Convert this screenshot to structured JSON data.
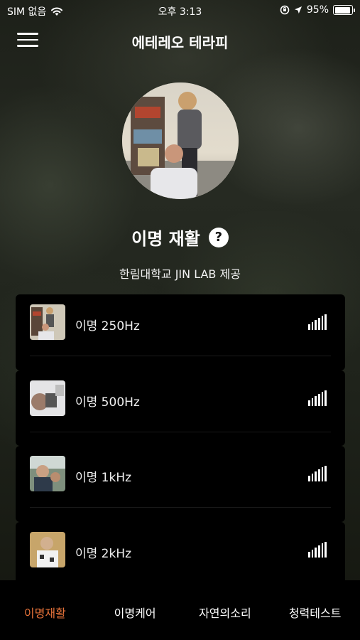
{
  "status_bar": {
    "carrier": "SIM 없음",
    "time": "오후 3:13",
    "battery": "95%",
    "battery_level": 0.95,
    "icons": [
      "wifi-icon",
      "orientation-lock-icon",
      "location-arrow-icon",
      "battery-icon"
    ]
  },
  "header": {
    "title": "에테레오 테라피",
    "menu_icon": "hamburger-menu-icon"
  },
  "section": {
    "title": "이명 재활",
    "help_label": "?",
    "provider": "한림대학교 JIN LAB 제공"
  },
  "tracks": [
    {
      "label": "이명 250Hz",
      "icon": "equalizer-icon"
    },
    {
      "label": "이명 500Hz",
      "icon": "equalizer-icon"
    },
    {
      "label": "이명 1kHz",
      "icon": "equalizer-icon"
    },
    {
      "label": "이명 2kHz",
      "icon": "equalizer-icon"
    }
  ],
  "tabs": [
    {
      "label": "이명재활",
      "active": true
    },
    {
      "label": "이명케어",
      "active": false
    },
    {
      "label": "자연의소리",
      "active": false
    },
    {
      "label": "청력테스트",
      "active": false
    }
  ],
  "colors": {
    "accent": "#e8733a",
    "card": "#000000",
    "tab_bar": "#000000"
  }
}
